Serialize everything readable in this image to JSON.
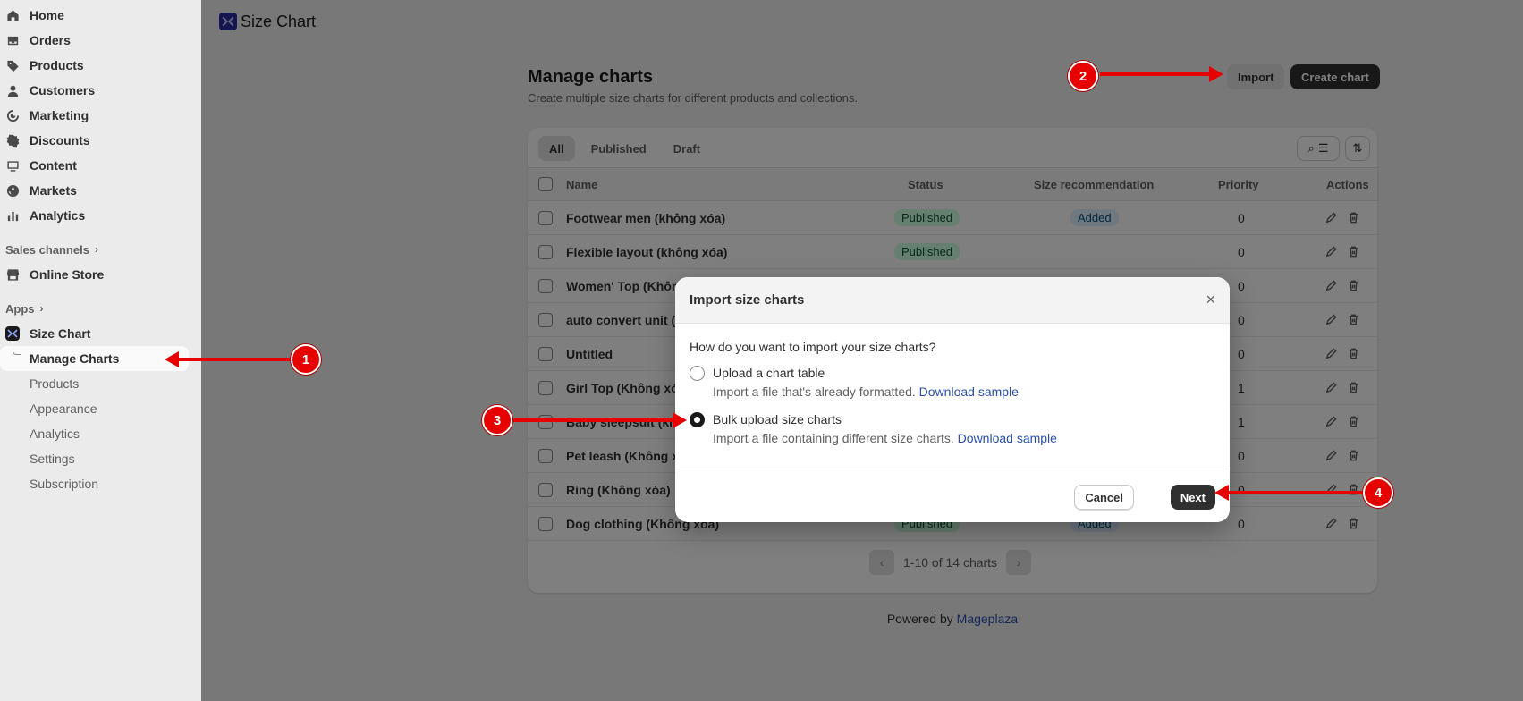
{
  "sidebar": {
    "nav": [
      {
        "label": "Home",
        "icon": "home-icon"
      },
      {
        "label": "Orders",
        "icon": "inbox-icon"
      },
      {
        "label": "Products",
        "icon": "tag-icon"
      },
      {
        "label": "Customers",
        "icon": "person-icon"
      },
      {
        "label": "Marketing",
        "icon": "target-icon"
      },
      {
        "label": "Discounts",
        "icon": "discount-icon"
      },
      {
        "label": "Content",
        "icon": "content-icon"
      },
      {
        "label": "Markets",
        "icon": "globe-icon"
      },
      {
        "label": "Analytics",
        "icon": "bar-chart-icon"
      }
    ],
    "sales_channels_label": "Sales channels",
    "online_store": "Online Store",
    "apps_label": "Apps",
    "app_name": "Size Chart",
    "app_items": [
      "Manage Charts",
      "Products",
      "Appearance",
      "Analytics",
      "Settings",
      "Subscription"
    ]
  },
  "topbar": {
    "title": "Size Chart"
  },
  "page": {
    "title": "Manage charts",
    "subtitle": "Create multiple size charts for different products and collections.",
    "import_label": "Import",
    "create_label": "Create chart",
    "tabs": [
      "All",
      "Published",
      "Draft"
    ],
    "columns": [
      "Name",
      "Status",
      "Size recommendation",
      "Priority",
      "Actions"
    ],
    "rows": [
      {
        "name": "Footwear men (không xóa)",
        "status": "Published",
        "size_rec": "Added",
        "priority": "0"
      },
      {
        "name": "Flexible layout (không xóa)",
        "status": "Published",
        "size_rec": "",
        "priority": "0"
      },
      {
        "name": "Women' Top (Không xóa)",
        "status": "",
        "size_rec": "",
        "priority": "0"
      },
      {
        "name": "auto convert unit (không xóa)",
        "status": "",
        "size_rec": "",
        "priority": "0"
      },
      {
        "name": "Untitled",
        "status": "",
        "size_rec": "",
        "priority": "0"
      },
      {
        "name": "Girl Top (Không xóa)",
        "status": "",
        "size_rec": "",
        "priority": "1"
      },
      {
        "name": "Baby sleepsuit (không xóa)",
        "status": "",
        "size_rec": "",
        "priority": "1"
      },
      {
        "name": "Pet leash (Không xóa)",
        "status": "",
        "size_rec": "",
        "priority": "0"
      },
      {
        "name": "Ring (Không xóa)",
        "status": "",
        "size_rec": "",
        "priority": "0"
      },
      {
        "name": "Dog clothing (Không xóa)",
        "status": "Published",
        "size_rec": "Added",
        "priority": "0"
      }
    ],
    "pagination": "1-10 of 14 charts",
    "powered_prefix": "Powered by",
    "powered_link": "Mageplaza"
  },
  "modal": {
    "title": "Import size charts",
    "question": "How do you want to import your size charts?",
    "option1_label": "Upload a chart table",
    "option1_desc": "Import a file that's already formatted.",
    "option1_link": "Download sample",
    "option2_label": "Bulk upload size charts",
    "option2_desc": "Import a file containing different size charts.",
    "option2_link": "Download sample",
    "selected_option": 2,
    "cancel_label": "Cancel",
    "next_label": "Next"
  },
  "annotations": [
    "1",
    "2",
    "3",
    "4"
  ],
  "colors": {
    "annotation": "#e60000",
    "primary_button": "#303030",
    "link": "#2a4fb0",
    "published_badge": "#cdfee1",
    "added_badge": "#e0f0ff"
  }
}
